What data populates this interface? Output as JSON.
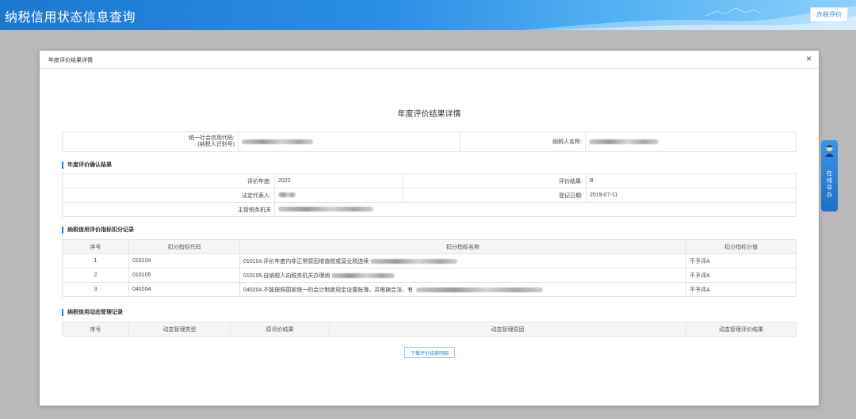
{
  "header": {
    "title": "纳税信用状态信息查询",
    "eval_button": "办税评价"
  },
  "modal": {
    "title": "年度评价结果详情",
    "close": "×",
    "heading": "年度评价结果详情"
  },
  "taxpayer": {
    "code_label_line1": "统一社会信用代码:",
    "code_label_line2": "(纳税人识别号)",
    "name_label": "纳税人名称:"
  },
  "annual": {
    "section_title": "年度评价确认结果",
    "year_label": "评价年度:",
    "year_value": "2022",
    "result_label": "评价结果:",
    "result_value": "B",
    "legal_label": "法定代表人:",
    "reg_date_label": "登记日期:",
    "reg_date_value": "2019-07-11",
    "authority_label": "主管税务机关"
  },
  "deduction": {
    "section_title": "纳税信用评价指标扣分记录",
    "headers": [
      "序号",
      "扣分指标代码",
      "扣分指标名称",
      "扣分指标分值"
    ],
    "rows": [
      {
        "no": "1",
        "code": "010104",
        "name": "010104.评价年度内非正常原因增值税或营业税连续",
        "score": "不予评A"
      },
      {
        "no": "2",
        "code": "010105",
        "name": "010105.自纳税人向税务机关办理纳",
        "score": "不予评A"
      },
      {
        "no": "3",
        "code": "040204",
        "name": "040204.不能按照国家统一的会计制度规定设置账簿，并根据合法、有",
        "score": "不予评A"
      }
    ]
  },
  "dynamic": {
    "section_title": "纳税信用动态管理记录",
    "headers": [
      "序号",
      "动态管理类型",
      "原评价结果",
      "动态管理原因",
      "动态管理评价结果"
    ]
  },
  "download_button": "下载评价结果明细",
  "side_tab": {
    "chars": [
      "在",
      "线",
      "导",
      "办"
    ]
  }
}
